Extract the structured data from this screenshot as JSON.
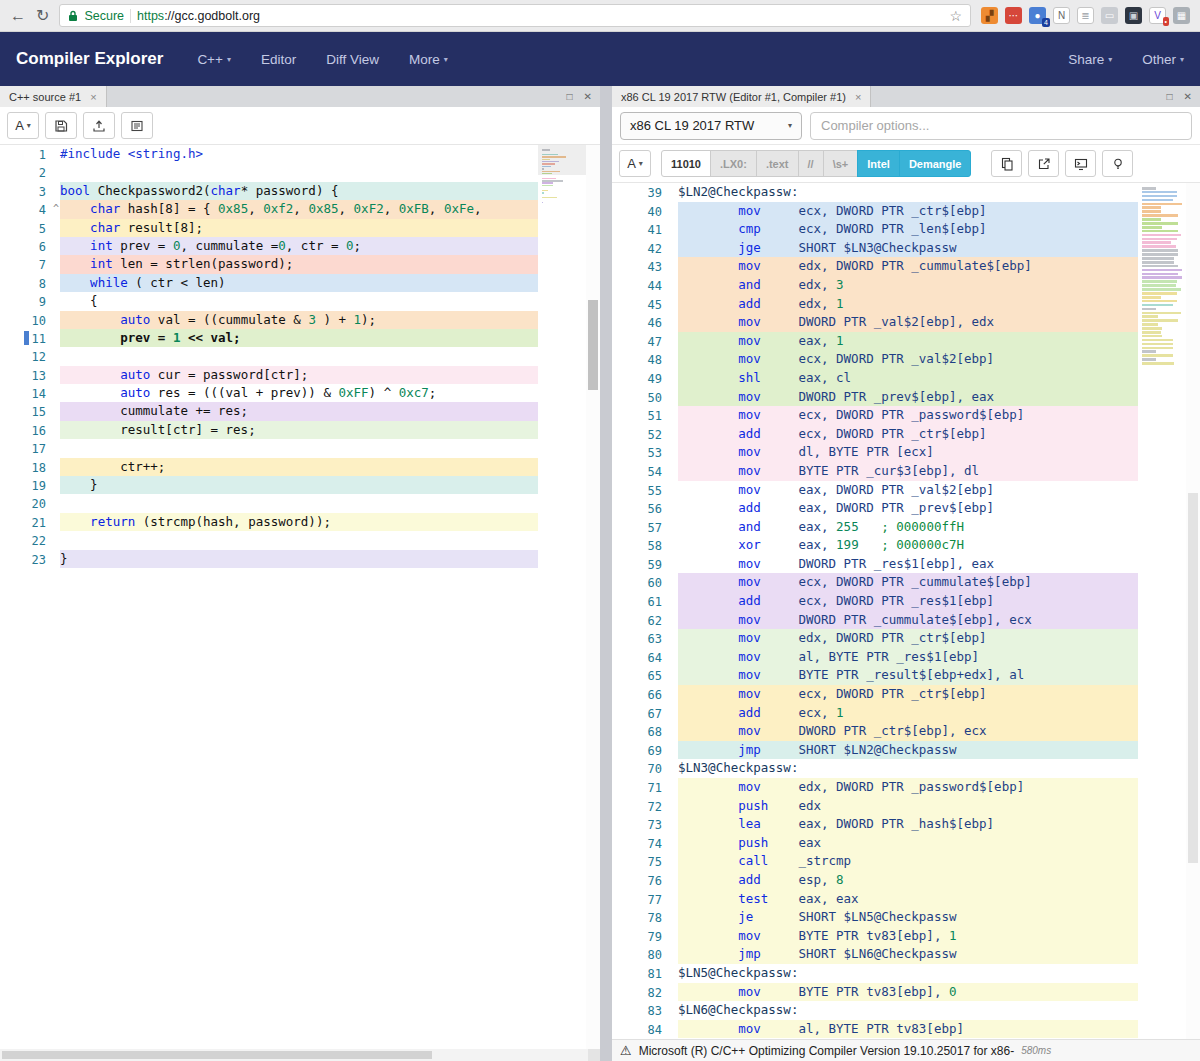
{
  "icons": {
    "back": "←",
    "reload": "↻",
    "star": "☆",
    "close": "×",
    "maximize": "□",
    "close_pane": "✕",
    "caret_down": "▾",
    "warning": "⚠",
    "font": "A",
    "fold": "^"
  },
  "browser": {
    "secure_label": "Secure",
    "url_scheme": "https",
    "url_rest": "://gcc.godbolt.org",
    "extensions": [
      {
        "name": "orange-monkey",
        "bg": "#ee8b32",
        "fg": "#7a4010",
        "glyph": "▞"
      },
      {
        "name": "red-tool",
        "bg": "#d6473a",
        "fg": "#ffffff",
        "glyph": "⋯"
      },
      {
        "name": "blue-profile",
        "bg": "#4a7fd4",
        "fg": "#ffffff",
        "glyph": "●",
        "badge": "4",
        "badge_bg": "#1a3f9e"
      },
      {
        "name": "letter-n",
        "bg": "#ffffff",
        "fg": "#666666",
        "glyph": "N",
        "border": true
      },
      {
        "name": "document",
        "bg": "#ffffff",
        "fg": "#9aa0a6",
        "glyph": "≣",
        "border": true
      },
      {
        "name": "gray-tool",
        "bg": "#c9ccd1",
        "fg": "#ffffff",
        "glyph": "▭"
      },
      {
        "name": "dark-box",
        "bg": "#2e3642",
        "fg": "#cdd3da",
        "glyph": "▣"
      },
      {
        "name": "v-purple",
        "bg": "#ffffff",
        "fg": "#6b46d8",
        "glyph": "V",
        "border": true,
        "badge": "•",
        "badge_bg": "#d64033"
      },
      {
        "name": "grid",
        "bg": "#aab0b6",
        "fg": "#ffffff",
        "glyph": "▦"
      }
    ]
  },
  "navbar": {
    "brand": "Compiler Explorer",
    "items": [
      {
        "label": "C++",
        "caret": true
      },
      {
        "label": "Editor",
        "caret": false
      },
      {
        "label": "Diff View",
        "caret": false
      },
      {
        "label": "More",
        "caret": true
      }
    ],
    "right_items": [
      {
        "label": "Share",
        "caret": true
      },
      {
        "label": "Other",
        "caret": true
      }
    ]
  },
  "source_pane": {
    "tab_title": "C++ source #1",
    "lines": [
      {
        "n": 1,
        "bg": "",
        "tk": [
          [
            "d",
            "#include <string.h>"
          ]
        ]
      },
      {
        "n": 2,
        "bg": "",
        "tk": []
      },
      {
        "n": 3,
        "bg": "teal",
        "tk": [
          [
            "k",
            "bool"
          ],
          [
            "p",
            " Checkpassword2("
          ],
          [
            "k",
            "char"
          ],
          [
            "p",
            "* password) {"
          ]
        ]
      },
      {
        "n": 4,
        "bg": "peach",
        "fold": true,
        "tk": [
          [
            "p",
            "    "
          ],
          [
            "k",
            "char"
          ],
          [
            "p",
            " hash[8] = { "
          ],
          [
            "n",
            "0x85"
          ],
          [
            "p",
            ", "
          ],
          [
            "n",
            "0xf2"
          ],
          [
            "p",
            ", "
          ],
          [
            "n",
            "0x85"
          ],
          [
            "p",
            ", "
          ],
          [
            "n",
            "0xF2"
          ],
          [
            "p",
            ", "
          ],
          [
            "n",
            "0xFB"
          ],
          [
            "p",
            ", "
          ],
          [
            "n",
            "0xFe"
          ],
          [
            "p",
            ","
          ]
        ]
      },
      {
        "n": 5,
        "bg": "yellow",
        "tk": [
          [
            "p",
            "    "
          ],
          [
            "k",
            "char"
          ],
          [
            "p",
            " result[8];"
          ]
        ]
      },
      {
        "n": 6,
        "bg": "lav",
        "tk": [
          [
            "p",
            "    "
          ],
          [
            "k",
            "int"
          ],
          [
            "p",
            " prev = "
          ],
          [
            "n",
            "0"
          ],
          [
            "p",
            ", cummulate ="
          ],
          [
            "n",
            "0"
          ],
          [
            "p",
            ", ctr = "
          ],
          [
            "n",
            "0"
          ],
          [
            "p",
            ";"
          ]
        ]
      },
      {
        "n": 7,
        "bg": "salmon",
        "tk": [
          [
            "p",
            "    "
          ],
          [
            "k",
            "int"
          ],
          [
            "p",
            " len = strlen(password);"
          ]
        ]
      },
      {
        "n": 8,
        "bg": "blue",
        "tk": [
          [
            "p",
            "    "
          ],
          [
            "k",
            "while"
          ],
          [
            "p",
            " ( ctr < len)"
          ]
        ]
      },
      {
        "n": 9,
        "bg": "",
        "tk": [
          [
            "p",
            "    {"
          ]
        ]
      },
      {
        "n": 10,
        "bg": "peach",
        "tk": [
          [
            "p",
            "        "
          ],
          [
            "k",
            "auto"
          ],
          [
            "p",
            " val = ((cummulate & "
          ],
          [
            "n",
            "3"
          ],
          [
            "p",
            " ) + "
          ],
          [
            "n",
            "1"
          ],
          [
            "p",
            ");"
          ]
        ]
      },
      {
        "n": 11,
        "bg": "green",
        "b": true,
        "marker": true,
        "tk": [
          [
            "p",
            "        prev = "
          ],
          [
            "n",
            "1"
          ],
          [
            "p",
            " << val;"
          ]
        ]
      },
      {
        "n": 12,
        "bg": "",
        "tk": []
      },
      {
        "n": 13,
        "bg": "pink",
        "tk": [
          [
            "p",
            "        "
          ],
          [
            "k",
            "auto"
          ],
          [
            "p",
            " cur = password[ctr];"
          ]
        ]
      },
      {
        "n": 14,
        "bg": "",
        "tk": [
          [
            "p",
            "        "
          ],
          [
            "k",
            "auto"
          ],
          [
            "p",
            " res = (((val + prev)) & "
          ],
          [
            "n",
            "0xFF"
          ],
          [
            "p",
            ") ^ "
          ],
          [
            "n",
            "0xc7"
          ],
          [
            "p",
            ";"
          ]
        ]
      },
      {
        "n": 15,
        "bg": "purple",
        "tk": [
          [
            "p",
            "        cummulate += res;"
          ]
        ]
      },
      {
        "n": 16,
        "bg": "mint",
        "tk": [
          [
            "p",
            "        result[ctr] = res;"
          ]
        ]
      },
      {
        "n": 17,
        "bg": "",
        "tk": []
      },
      {
        "n": 18,
        "bg": "yellow",
        "tk": [
          [
            "p",
            "        ctr++;"
          ]
        ]
      },
      {
        "n": 19,
        "bg": "teal",
        "tk": [
          [
            "p",
            "    }"
          ]
        ]
      },
      {
        "n": 20,
        "bg": "",
        "tk": []
      },
      {
        "n": 21,
        "bg": "pale",
        "tk": [
          [
            "p",
            "    "
          ],
          [
            "k",
            "return"
          ],
          [
            "p",
            " (strcmp(hash, password));"
          ]
        ]
      },
      {
        "n": 22,
        "bg": "",
        "tk": []
      },
      {
        "n": 23,
        "bg": "lav",
        "tk": [
          [
            "p",
            "}"
          ]
        ]
      }
    ]
  },
  "asm_pane": {
    "tab_title": "x86 CL 19 2017 RTW (Editor #1, Compiler #1)",
    "compiler_select": "x86 CL 19 2017 RTW",
    "options_placeholder": "Compiler options...",
    "filters": [
      {
        "label": "11010",
        "style": "plain"
      },
      {
        "label": ".LX0:",
        "style": "muted"
      },
      {
        "label": ".text",
        "style": "muted"
      },
      {
        "label": "//",
        "style": "muted"
      },
      {
        "label": "\\s+",
        "style": "muted"
      },
      {
        "label": "Intel",
        "style": "active"
      },
      {
        "label": "Demangle",
        "style": "active"
      }
    ],
    "status_text": "Microsoft (R) C/C++ Optimizing Compiler Version 19.10.25017 for x86-",
    "status_time": "580ms",
    "lines": [
      {
        "n": 39,
        "bg": "",
        "l": "$LN2@Checkpassw:"
      },
      {
        "n": 40,
        "bg": "blue",
        "m": "mov",
        "o": [
          [
            "o",
            "ecx, DWORD PTR _ctr$[ebp]"
          ]
        ]
      },
      {
        "n": 41,
        "bg": "blue",
        "m": "cmp",
        "o": [
          [
            "o",
            "ecx, DWORD PTR _len$[ebp]"
          ]
        ]
      },
      {
        "n": 42,
        "bg": "blue",
        "m": "jge",
        "o": [
          [
            "o",
            "SHORT $LN3@Checkpassw"
          ]
        ]
      },
      {
        "n": 43,
        "bg": "peach",
        "m": "mov",
        "o": [
          [
            "o",
            "edx, DWORD PTR _cummulate$[ebp]"
          ]
        ]
      },
      {
        "n": 44,
        "bg": "peach",
        "m": "and",
        "o": [
          [
            "o",
            "edx, "
          ],
          [
            "nu",
            "3"
          ]
        ]
      },
      {
        "n": 45,
        "bg": "peach",
        "m": "add",
        "o": [
          [
            "o",
            "edx, "
          ],
          [
            "nu",
            "1"
          ]
        ]
      },
      {
        "n": 46,
        "bg": "peach",
        "m": "mov",
        "o": [
          [
            "o",
            "DWORD PTR _val$2[ebp], edx"
          ]
        ]
      },
      {
        "n": 47,
        "bg": "green",
        "m": "mov",
        "o": [
          [
            "o",
            "eax, "
          ],
          [
            "nu",
            "1"
          ]
        ]
      },
      {
        "n": 48,
        "bg": "green",
        "m": "mov",
        "o": [
          [
            "o",
            "ecx, DWORD PTR _val$2[ebp]"
          ]
        ]
      },
      {
        "n": 49,
        "bg": "green",
        "m": "shl",
        "o": [
          [
            "o",
            "eax, cl"
          ]
        ]
      },
      {
        "n": 50,
        "bg": "green",
        "m": "mov",
        "o": [
          [
            "o",
            "DWORD PTR _prev$[ebp], eax"
          ]
        ]
      },
      {
        "n": 51,
        "bg": "pink",
        "m": "mov",
        "o": [
          [
            "o",
            "ecx, DWORD PTR _password$[ebp]"
          ]
        ]
      },
      {
        "n": 52,
        "bg": "pink",
        "m": "add",
        "o": [
          [
            "o",
            "ecx, DWORD PTR _ctr$[ebp]"
          ]
        ]
      },
      {
        "n": 53,
        "bg": "pink",
        "m": "mov",
        "o": [
          [
            "o",
            "dl, BYTE PTR [ecx]"
          ]
        ]
      },
      {
        "n": 54,
        "bg": "pink",
        "m": "mov",
        "o": [
          [
            "o",
            "BYTE PTR _cur$3[ebp], dl"
          ]
        ]
      },
      {
        "n": 55,
        "bg": "",
        "m": "mov",
        "o": [
          [
            "o",
            "eax, DWORD PTR _val$2[ebp]"
          ]
        ]
      },
      {
        "n": 56,
        "bg": "",
        "m": "add",
        "o": [
          [
            "o",
            "eax, DWORD PTR _prev$[ebp]"
          ]
        ]
      },
      {
        "n": 57,
        "bg": "",
        "m": "and",
        "o": [
          [
            "o",
            "eax, "
          ],
          [
            "nu",
            "255"
          ],
          [
            "o",
            "   "
          ],
          [
            "cm",
            "; 000000ffH"
          ]
        ]
      },
      {
        "n": 58,
        "bg": "",
        "m": "xor",
        "o": [
          [
            "o",
            "eax, "
          ],
          [
            "nu",
            "199"
          ],
          [
            "o",
            "   "
          ],
          [
            "cm",
            "; 000000c7H"
          ]
        ]
      },
      {
        "n": 59,
        "bg": "",
        "m": "mov",
        "o": [
          [
            "o",
            "DWORD PTR _res$1[ebp], eax"
          ]
        ]
      },
      {
        "n": 60,
        "bg": "purple",
        "m": "mov",
        "o": [
          [
            "o",
            "ecx, DWORD PTR _cummulate$[ebp]"
          ]
        ]
      },
      {
        "n": 61,
        "bg": "purple",
        "m": "add",
        "o": [
          [
            "o",
            "ecx, DWORD PTR _res$1[ebp]"
          ]
        ]
      },
      {
        "n": 62,
        "bg": "purple",
        "m": "mov",
        "o": [
          [
            "o",
            "DWORD PTR _cummulate$[ebp], ecx"
          ]
        ]
      },
      {
        "n": 63,
        "bg": "mint",
        "m": "mov",
        "o": [
          [
            "o",
            "edx, DWORD PTR _ctr$[ebp]"
          ]
        ]
      },
      {
        "n": 64,
        "bg": "mint",
        "m": "mov",
        "o": [
          [
            "o",
            "al, BYTE PTR _res$1[ebp]"
          ]
        ]
      },
      {
        "n": 65,
        "bg": "mint",
        "m": "mov",
        "o": [
          [
            "o",
            "BYTE PTR _result$[ebp+edx], al"
          ]
        ]
      },
      {
        "n": 66,
        "bg": "yellow",
        "m": "mov",
        "o": [
          [
            "o",
            "ecx, DWORD PTR _ctr$[ebp]"
          ]
        ]
      },
      {
        "n": 67,
        "bg": "yellow",
        "m": "add",
        "o": [
          [
            "o",
            "ecx, "
          ],
          [
            "nu",
            "1"
          ]
        ]
      },
      {
        "n": 68,
        "bg": "yellow",
        "m": "mov",
        "o": [
          [
            "o",
            "DWORD PTR _ctr$[ebp], ecx"
          ]
        ]
      },
      {
        "n": 69,
        "bg": "teal",
        "m": "jmp",
        "o": [
          [
            "o",
            "SHORT $LN2@Checkpassw"
          ]
        ]
      },
      {
        "n": 70,
        "bg": "",
        "l": "$LN3@Checkpassw:"
      },
      {
        "n": 71,
        "bg": "pale",
        "m": "mov",
        "o": [
          [
            "o",
            "edx, DWORD PTR _password$[ebp]"
          ]
        ]
      },
      {
        "n": 72,
        "bg": "pale",
        "m": "push",
        "o": [
          [
            "o",
            "edx"
          ]
        ]
      },
      {
        "n": 73,
        "bg": "pale",
        "m": "lea",
        "o": [
          [
            "o",
            "eax, DWORD PTR _hash$[ebp]"
          ]
        ]
      },
      {
        "n": 74,
        "bg": "pale",
        "m": "push",
        "o": [
          [
            "o",
            "eax"
          ]
        ]
      },
      {
        "n": 75,
        "bg": "pale",
        "m": "call",
        "o": [
          [
            "o",
            "_strcmp"
          ]
        ]
      },
      {
        "n": 76,
        "bg": "pale",
        "m": "add",
        "o": [
          [
            "o",
            "esp, "
          ],
          [
            "nu",
            "8"
          ]
        ]
      },
      {
        "n": 77,
        "bg": "pale",
        "m": "test",
        "o": [
          [
            "o",
            "eax, eax"
          ]
        ]
      },
      {
        "n": 78,
        "bg": "pale",
        "m": "je",
        "o": [
          [
            "o",
            "SHORT $LN5@Checkpassw"
          ]
        ]
      },
      {
        "n": 79,
        "bg": "pale",
        "m": "mov",
        "o": [
          [
            "o",
            "BYTE PTR tv83[ebp], "
          ],
          [
            "nu",
            "1"
          ]
        ]
      },
      {
        "n": 80,
        "bg": "pale",
        "m": "jmp",
        "o": [
          [
            "o",
            "SHORT $LN6@Checkpassw"
          ]
        ]
      },
      {
        "n": 81,
        "bg": "",
        "l": "$LN5@Checkpassw:"
      },
      {
        "n": 82,
        "bg": "pale",
        "m": "mov",
        "o": [
          [
            "o",
            "BYTE PTR tv83[ebp], "
          ],
          [
            "nu",
            "0"
          ]
        ]
      },
      {
        "n": 83,
        "bg": "",
        "l": "$LN6@Checkpassw:"
      },
      {
        "n": 84,
        "bg": "pale",
        "m": "mov",
        "o": [
          [
            "o",
            "al, BYTE PTR tv83[ebp]"
          ]
        ]
      }
    ]
  }
}
